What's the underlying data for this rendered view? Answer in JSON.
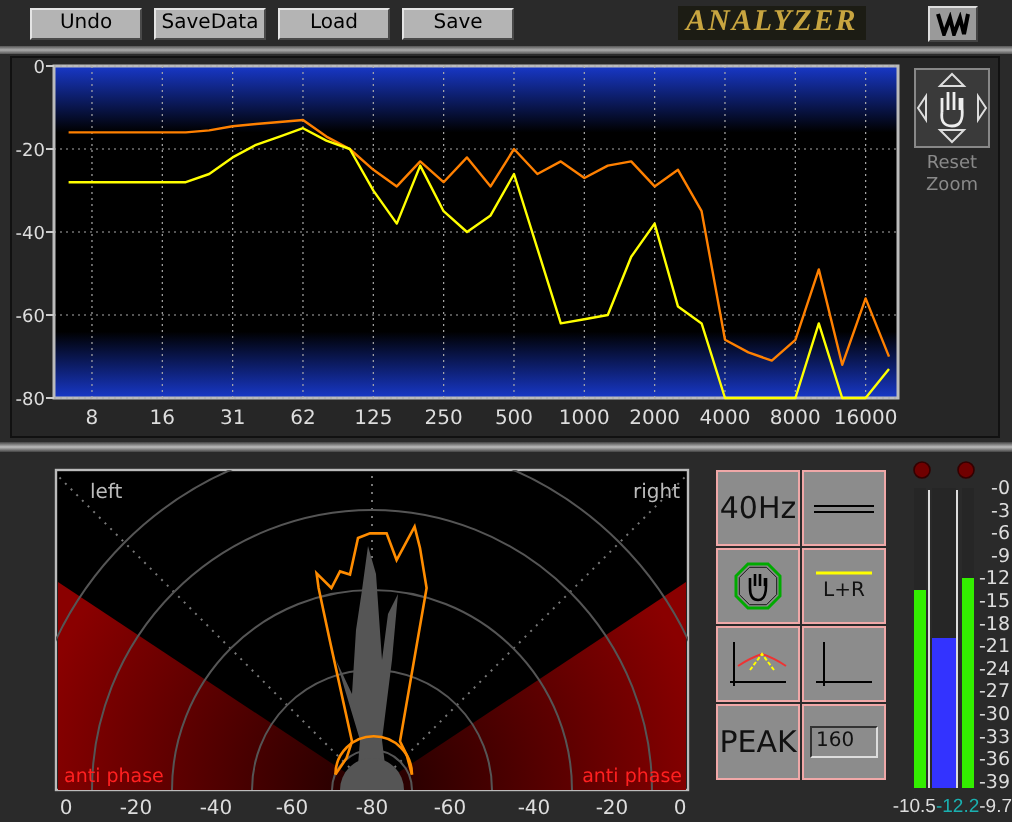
{
  "toolbar": {
    "buttons": [
      {
        "label": "Undo"
      },
      {
        "label": "SaveData"
      },
      {
        "label": "Load"
      },
      {
        "label": "Save"
      }
    ],
    "title": "ANALYZER"
  },
  "spectrum": {
    "chart_data": {
      "type": "line",
      "categories": [
        null,
        "8",
        null,
        null,
        "16",
        null,
        null,
        "31",
        null,
        null,
        "62",
        null,
        null,
        "125",
        null,
        null,
        "250",
        null,
        null,
        "500",
        null,
        null,
        "1000",
        null,
        null,
        "2000",
        null,
        null,
        "4000",
        null,
        null,
        "8000",
        null,
        null,
        "16000",
        null
      ],
      "series": [
        {
          "color": "#ff8000",
          "values": [
            -16,
            -16,
            -16,
            -16,
            -16,
            -16,
            -15.5,
            -14.5,
            -14,
            -13.5,
            -13,
            -17,
            -20,
            -25,
            -29,
            -23,
            -28,
            -22,
            -29,
            -20,
            -26,
            -23,
            -27,
            -24,
            -23,
            -29,
            -25,
            -35,
            -66,
            -69,
            -71,
            -66,
            -49,
            -72,
            -56,
            -70
          ]
        },
        {
          "color": "#ffff00",
          "values": [
            -28,
            -28,
            -28,
            -28,
            -28,
            -28,
            -26,
            -22,
            -19,
            -17,
            -15,
            -18,
            -20,
            -30,
            -38,
            -24,
            -35,
            -40,
            -36,
            -26,
            -44,
            -62,
            -61,
            -60,
            -46,
            -38,
            -58,
            -62,
            -80,
            -80,
            -80,
            -80,
            -62,
            -80,
            -80,
            -73
          ]
        }
      ],
      "ylim": [
        -80,
        0
      ],
      "grid": true,
      "yticks": [
        0,
        -20,
        -40,
        -60,
        -80
      ]
    }
  },
  "zoom_control": {
    "reset_label": "Reset Zoom",
    "disabled": true
  },
  "phase_scope": {
    "left_label": "left",
    "right_label": "right",
    "anti_phase_labels": [
      "anti phase",
      "anti phase"
    ],
    "scale_labels": [
      "0",
      "-20",
      "-40",
      "-60",
      "-80",
      "-60",
      "-40",
      "-20",
      "0"
    ]
  },
  "controls": [
    {
      "kind": "text",
      "label": "40Hz"
    },
    {
      "kind": "double-line"
    },
    {
      "kind": "hand"
    },
    {
      "kind": "lr",
      "label": "L+R"
    },
    {
      "kind": "curve"
    },
    {
      "kind": "axes"
    },
    {
      "kind": "text",
      "label": "PEAK"
    },
    {
      "kind": "field",
      "value": "160"
    }
  ],
  "meters": {
    "clip_leds": [
      {
        "on": false
      },
      {
        "on": false
      }
    ],
    "bars": [
      {
        "kind": "peak",
        "level": 0.66
      },
      {
        "kind": "rms",
        "level": 0.5
      },
      {
        "kind": "peak",
        "level": 0.7
      }
    ],
    "scale": [
      "-0",
      "-3",
      "-6",
      "-9",
      "-12",
      "-15",
      "-18",
      "-21",
      "-24",
      "-27",
      "-30",
      "-33",
      "-36",
      "-39"
    ],
    "readings": [
      {
        "kind": "peak",
        "text": "-10.5"
      },
      {
        "kind": "rms",
        "text": "-12.2"
      },
      {
        "kind": "peak",
        "text": "-9.7"
      }
    ]
  }
}
